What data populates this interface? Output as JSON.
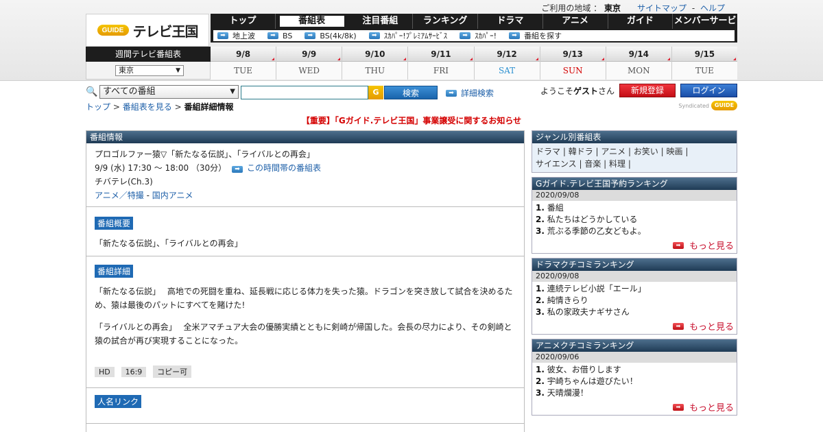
{
  "util": {
    "area_label": "ご利用の地域 ：",
    "area_value": "東京",
    "sitemap": "サイトマップ",
    "sep": "-",
    "help": "ヘルプ"
  },
  "logo": {
    "mark": "GUIDE",
    "text": "テレビ王国"
  },
  "nav": {
    "items": [
      "トップ",
      "番組表",
      "注目番組",
      "ランキング",
      "ドラマ",
      "アニメ",
      "ガイド",
      "メンバーサービス"
    ]
  },
  "subnav": {
    "items": [
      "地上波",
      "BS",
      "BS(4k/8k)",
      "ｽｶﾊﾟｰ!ﾌﾟﾚﾐｱﾑｻｰﾋﾞｽ",
      "ｽｶﾊﾟｰ!",
      "番組を探す"
    ]
  },
  "weekly": "週間テレビ番組表",
  "region": "東京",
  "days": [
    {
      "d": "9/8",
      "w": "TUE",
      "c": "#555555"
    },
    {
      "d": "9/9",
      "w": "WED",
      "c": "#555555"
    },
    {
      "d": "9/10",
      "w": "THU",
      "c": "#555555"
    },
    {
      "d": "9/11",
      "w": "FRI",
      "c": "#555555"
    },
    {
      "d": "9/12",
      "w": "SAT",
      "c": "#2a8fd0"
    },
    {
      "d": "9/13",
      "w": "SUN",
      "c": "#d40000"
    },
    {
      "d": "9/14",
      "w": "MON",
      "c": "#555555"
    },
    {
      "d": "9/15",
      "w": "TUE",
      "c": "#555555"
    }
  ],
  "search": {
    "genre": "すべての番組",
    "input": "",
    "button": "検索",
    "advanced": "詳細検索"
  },
  "welcome": {
    "pre": "ようこそ",
    "name": "ゲスト",
    "post": "さん"
  },
  "register": "新規登録",
  "login": "ログイン",
  "syndicated": "Syndicated",
  "crumb": {
    "top": "トップ",
    "sep": ">",
    "listing": "番組表を見る",
    "current": "番組詳細情報"
  },
  "notice": "【重要】「Gガイド.テレビ王国」事業譲受に関するお知らせ",
  "program": {
    "header": "番組情報",
    "title": "プロゴルファー猿▽「新たなる伝説」、「ライバルとの再会」",
    "time": "9/9 (水) 17:30 ～ 18:00 （30分）",
    "time_link": "この時間帯の番組表",
    "channel": "チバテレ(Ch.3)",
    "genre1": "アニメ／特撮",
    "genre_sep": "-",
    "genre2": "国内アニメ",
    "summary_label": "番組概要",
    "summary": "「新たなる伝説」、「ライバルとの再会」",
    "detail_label": "番組詳細",
    "detail1": "「新たなる伝説」　 高地での死闘を重ね、延長戦に応じる体力を失った猿。ドラゴンを突き放して試合を決めるため、猿は最後のパットにすべてを賭けた!",
    "detail2": "「ライバルとの再会」　 全米アマチュア大会の優勝実績とともに剣崎が帰国した。会長の尽力により、その剣崎と猿の試合が再び実現することになった。",
    "tags": [
      "HD",
      "16:9",
      "コピー可"
    ],
    "people_label": "人名リンク"
  },
  "sidebar": {
    "genre_header": "ジャンル別番組表",
    "genres": [
      "ドラマ",
      "韓ドラ",
      "アニメ",
      "お笑い",
      "映画",
      "サイエンス",
      "音楽",
      "料理"
    ],
    "rankings": [
      {
        "header": "Gガイド.テレビ王国予約ランキング",
        "date": "2020/09/08",
        "items": [
          "番組",
          "私たちはどうかしている",
          "荒ぶる季節の乙女どもよ。"
        ]
      },
      {
        "header": "ドラマクチコミランキング",
        "date": "2020/09/08",
        "items": [
          "連続テレビ小説「エール」",
          "純情きらり",
          "私の家政夫ナギサさん"
        ]
      },
      {
        "header": "アニメクチコミランキング",
        "date": "2020/09/06",
        "items": [
          "彼女、お借りします",
          "宇崎ちゃんは遊びたい！",
          "天晴爛漫！"
        ]
      }
    ],
    "more": "もっと見る"
  }
}
